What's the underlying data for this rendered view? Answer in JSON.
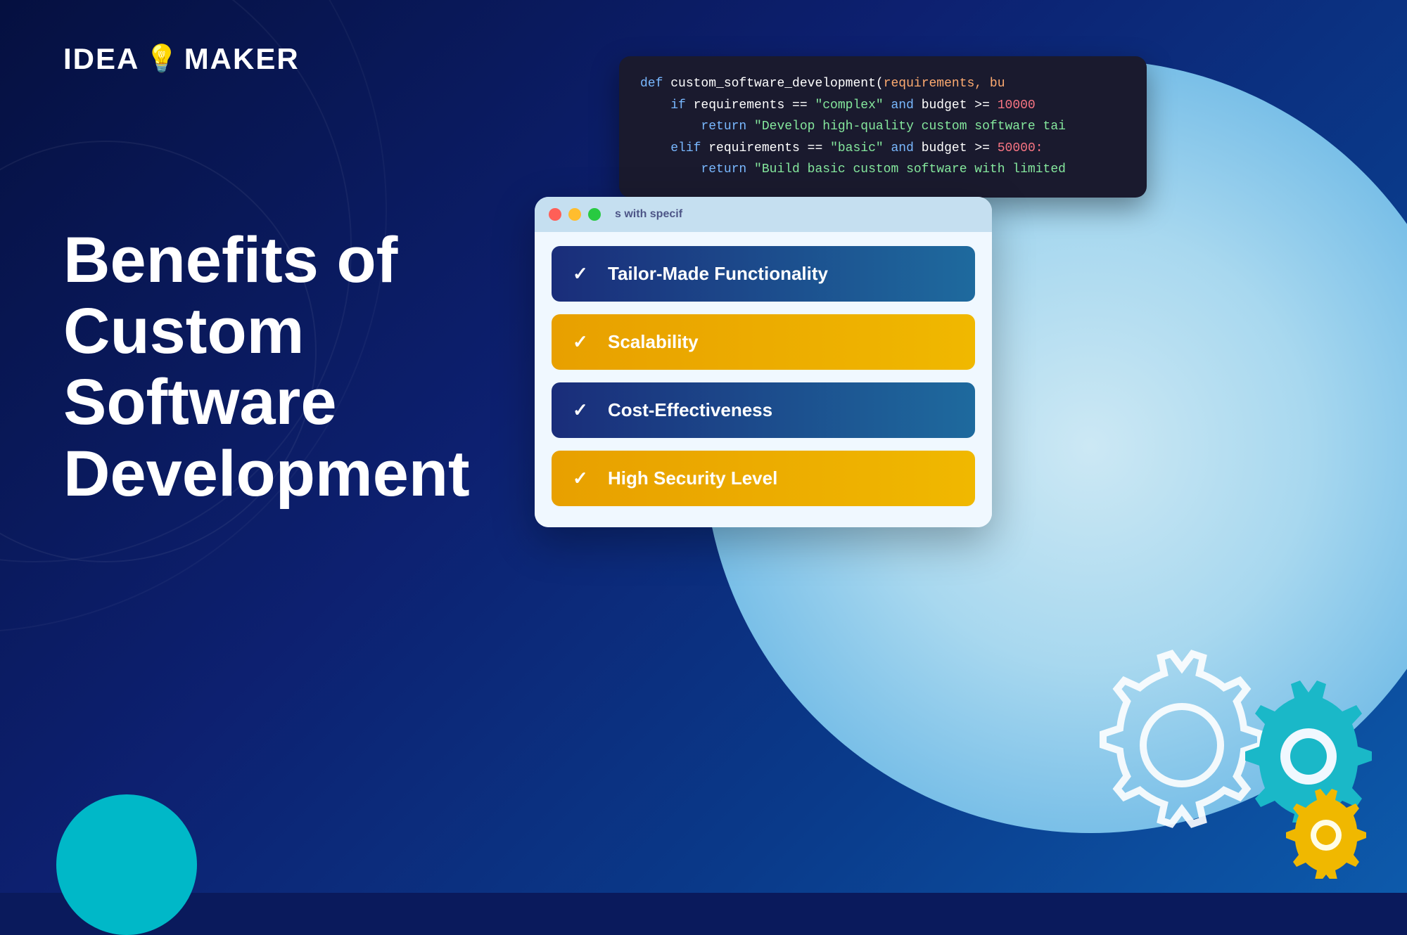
{
  "logo": {
    "idea": "IDEA",
    "maker": "MAKER",
    "bulb_icon": "💡"
  },
  "headline": {
    "line1": "Benefits of",
    "line2": "Custom Software",
    "line3": "Development"
  },
  "window": {
    "titlebar_text": "s with specif",
    "benefits": [
      {
        "id": 1,
        "label": "Tailor-Made Functionality",
        "style": "dark-blue"
      },
      {
        "id": 2,
        "label": "Scalability",
        "style": "gold"
      },
      {
        "id": 3,
        "label": "Cost-Effectiveness",
        "style": "dark-blue"
      },
      {
        "id": 4,
        "label": "High Security Level",
        "style": "gold"
      }
    ]
  },
  "code_editor": {
    "lines": [
      {
        "id": 1,
        "content": "def custom_software_development(requirements, bu"
      },
      {
        "id": 2,
        "content": "    if requirements == \"complex\" and budget >= 10000"
      },
      {
        "id": 3,
        "content": "        return \"Develop high-quality custom software tai"
      },
      {
        "id": 4,
        "content": "    elif requirements == \"basic\" and budget >= 50000:"
      },
      {
        "id": 5,
        "content": "        return \"Build basic custom software with limited"
      }
    ]
  },
  "colors": {
    "bg_dark": "#051040",
    "bg_mid": "#0d2070",
    "accent_cyan": "#00b8c8",
    "accent_gold": "#f0b800",
    "card_dark": "#1a2d7a",
    "card_teal": "#1e6a9e",
    "light_circle": "#b8ddf0"
  }
}
